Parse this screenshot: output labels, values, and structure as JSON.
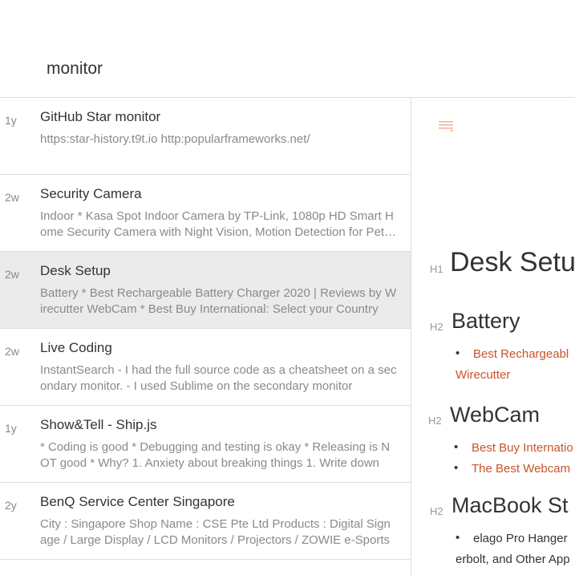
{
  "search": {
    "query": "monitor"
  },
  "notes": [
    {
      "age": "1y",
      "title": "GitHub Star monitor",
      "preview": "https:star-history.t9t.io http:popularframeworks.net/"
    },
    {
      "age": "2w",
      "title": "Security Camera",
      "preview": "Indoor * Kasa Spot Indoor Camera by TP-Link, 1080p HD Smart Home Security Camera with Night Vision, Motion Detection for Pet Monitor"
    },
    {
      "age": "2w",
      "title": "Desk Setup",
      "preview": "Battery * Best Rechargeable Battery Charger 2020 | Reviews by Wirecutter WebCam * Best Buy International: Select your Country"
    },
    {
      "age": "2w",
      "title": "Live Coding",
      "preview": "InstantSearch - I had the full source code as a cheatsheet on a secondary monitor. - I used Sublime on the secondary monitor"
    },
    {
      "age": "1y",
      "title": "Show&Tell - Ship.js",
      "preview": "* Coding is good * Debugging and testing is okay * Releasing is NOT good * Why? 1. Anxiety about breaking things 1. Write down"
    },
    {
      "age": "2y",
      "title": "BenQ Service Center Singapore",
      "preview": "City : Singapore Shop Name : CSE Pte Ltd Products : Digital Signage / Large Display / LCD Monitors / Projectors / ZOWIE e-Sports"
    }
  ],
  "editor": {
    "h1_marker": "H1",
    "h2_marker": "H2",
    "title": "Desk Setu",
    "sections": {
      "battery": {
        "heading": "Battery",
        "link1_a": "Best Rechargeabl",
        "link1_b": "Wirecutter"
      },
      "webcam": {
        "heading": "WebCam",
        "link1": "Best Buy Internatio",
        "link2": "The Best Webcam"
      },
      "macbook": {
        "heading": "MacBook St",
        "item1_a": "elago Pro Hanger",
        "item1_b": "erbolt, and Other App"
      }
    }
  },
  "colors": {
    "link": "#c8542a",
    "selected_row": "#ebebeb",
    "divider": "#dedede"
  }
}
